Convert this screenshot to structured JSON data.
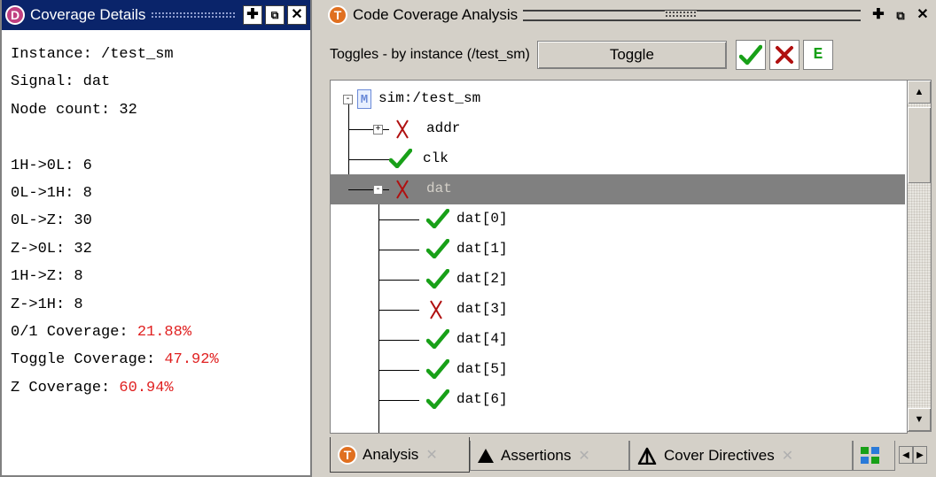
{
  "colors": {
    "accent": "#0a246a",
    "check": "#18a018",
    "cross": "#b01010",
    "percent": "#e02020",
    "selected_row": "#808080"
  },
  "left_panel": {
    "title": "Coverage Details",
    "icon_letter": "D",
    "lines": [
      {
        "label": "Instance: /test_sm",
        "value": ""
      },
      {
        "label": "Signal: dat",
        "value": ""
      },
      {
        "label": "Node count: 32",
        "value": ""
      },
      {
        "label": "",
        "value": ""
      },
      {
        "label": "1H->0L: 6",
        "value": ""
      },
      {
        "label": "0L->1H: 8",
        "value": ""
      },
      {
        "label": "0L->Z: 30",
        "value": ""
      },
      {
        "label": "Z->0L: 32",
        "value": ""
      },
      {
        "label": "1H->Z: 8",
        "value": ""
      },
      {
        "label": "Z->1H: 8",
        "value": ""
      },
      {
        "label": "0/1 Coverage: ",
        "value": "21.88%"
      },
      {
        "label": "Toggle Coverage: ",
        "value": "47.92%"
      },
      {
        "label": "Z Coverage: ",
        "value": "60.94%"
      }
    ]
  },
  "right_panel": {
    "title": "Code Coverage Analysis",
    "icon_letter": "T",
    "toolbar": {
      "label": "Toggles - by instance (/test_sm)",
      "toggle_button": "Toggle",
      "e_button": "E"
    },
    "tree": [
      {
        "label": "sim:/test_sm",
        "icon": "module-icon",
        "level": 0,
        "expander": "-"
      },
      {
        "label": "addr",
        "icon": "cross-icon",
        "level": 1,
        "expander": "+"
      },
      {
        "label": "clk",
        "icon": "check-icon",
        "level": 1,
        "expander": ""
      },
      {
        "label": "dat",
        "icon": "cross-icon",
        "level": 1,
        "expander": "-",
        "selected": true
      },
      {
        "label": "dat[0]",
        "icon": "check-icon",
        "level": 2,
        "expander": ""
      },
      {
        "label": "dat[1]",
        "icon": "check-icon",
        "level": 2,
        "expander": ""
      },
      {
        "label": "dat[2]",
        "icon": "check-icon",
        "level": 2,
        "expander": ""
      },
      {
        "label": "dat[3]",
        "icon": "cross-icon",
        "level": 2,
        "expander": ""
      },
      {
        "label": "dat[4]",
        "icon": "check-icon",
        "level": 2,
        "expander": ""
      },
      {
        "label": "dat[5]",
        "icon": "check-icon",
        "level": 2,
        "expander": ""
      },
      {
        "label": "dat[6]",
        "icon": "check-icon",
        "level": 2,
        "expander": ""
      }
    ],
    "tabs": [
      {
        "label": "Analysis",
        "icon": "coverage-t-icon",
        "active": true
      },
      {
        "label": "Assertions",
        "icon": "assertion-triangle-icon",
        "active": false
      },
      {
        "label": "Cover Directives",
        "icon": "cover-directive-icon",
        "active": false
      }
    ]
  }
}
